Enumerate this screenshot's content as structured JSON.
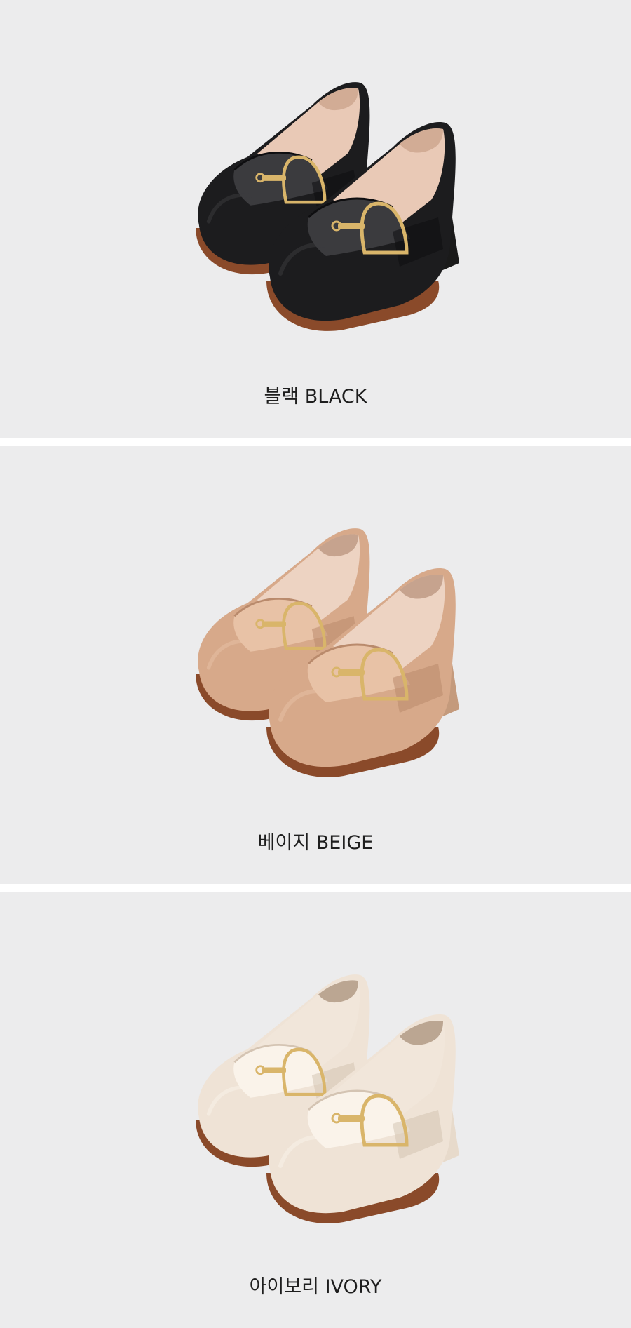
{
  "products": [
    {
      "label": "블랙 BLACK",
      "colors": {
        "leather": "#1c1c1e",
        "leather_shade": "#0e0e10",
        "leather_light": "#3b3b3e",
        "lining": "#e9c9b6",
        "lining_dark": "#c89f88",
        "sole": "#8a4a2a",
        "heel": "#1a1a1a",
        "buckle": "#d9b56a"
      }
    },
    {
      "label": "베이지 BEIGE",
      "colors": {
        "leather": "#d7a98a",
        "leather_shade": "#b98a6c",
        "leather_light": "#e8c2a6",
        "lining": "#edd3c2",
        "lining_dark": "#b58e77",
        "sole": "#8a4a2a",
        "heel": "#c49a7c",
        "buckle": "#d9b56a"
      }
    },
    {
      "label": "아이보리 IVORY",
      "colors": {
        "leather": "#efe3d6",
        "leather_shade": "#d4c4b3",
        "leather_light": "#faf3ea",
        "lining": "#f1e6da",
        "lining_dark": "#a48a74",
        "sole": "#8a4a2a",
        "heel": "#e7dacb",
        "buckle": "#d9b56a"
      }
    }
  ]
}
